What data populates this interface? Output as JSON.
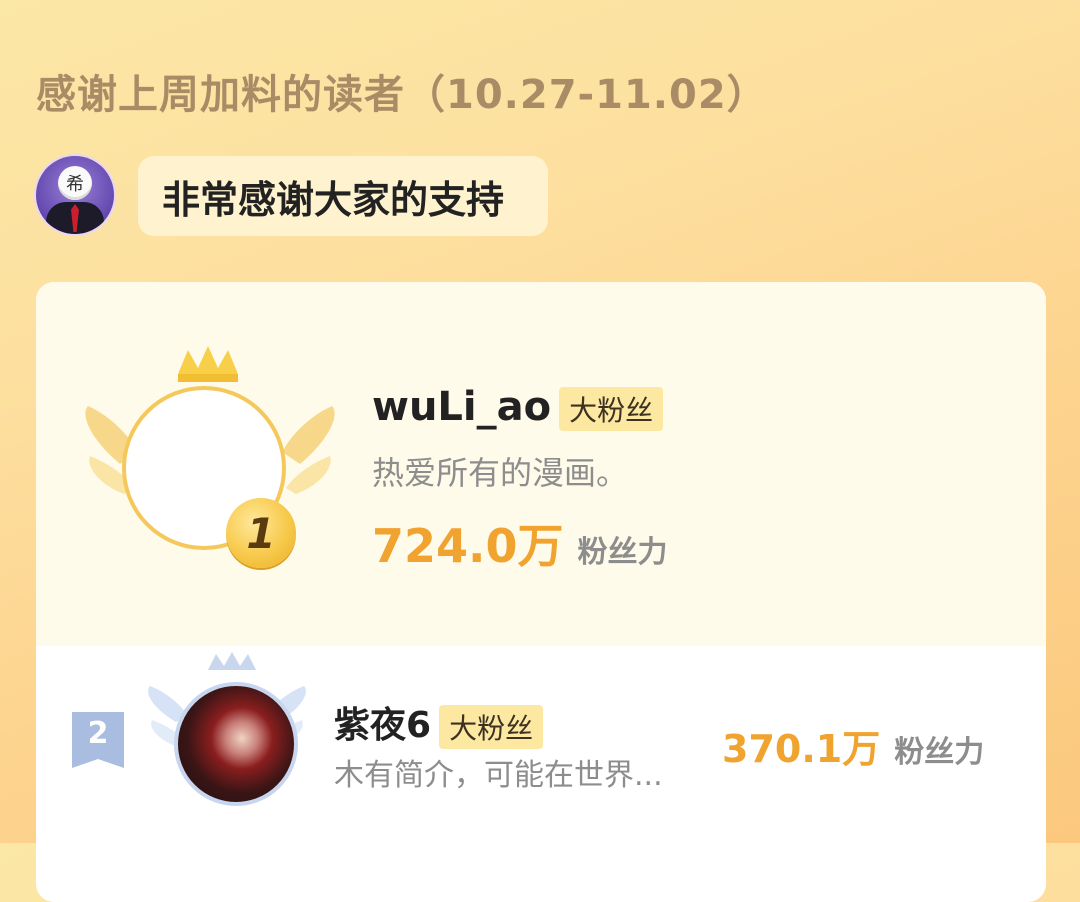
{
  "page": {
    "title": "感谢上周加料的读者（10.27-11.02）"
  },
  "message": {
    "avatar_glyph": "希",
    "text": "非常感谢大家的支持"
  },
  "ranking": [
    {
      "rank": "1",
      "name": "wuLi_ao",
      "badge": "大粉丝",
      "bio": "热爱所有的漫画。",
      "power": "724.0万",
      "power_label": "粉丝力"
    },
    {
      "rank": "2",
      "name": "紫夜6",
      "badge": "大粉丝",
      "bio": "木有简介，可能在世界...",
      "power": "370.1万",
      "power_label": "粉丝力"
    }
  ],
  "colors": {
    "accent": "#f0a32e",
    "muted": "#8d8d8d",
    "gold": "#f5c85c",
    "silver": "#a9bde0"
  },
  "icons": {
    "crown": "crown-icon",
    "wings": "wings-icon",
    "medal": "medal-icon",
    "ribbon": "ribbon-icon"
  }
}
